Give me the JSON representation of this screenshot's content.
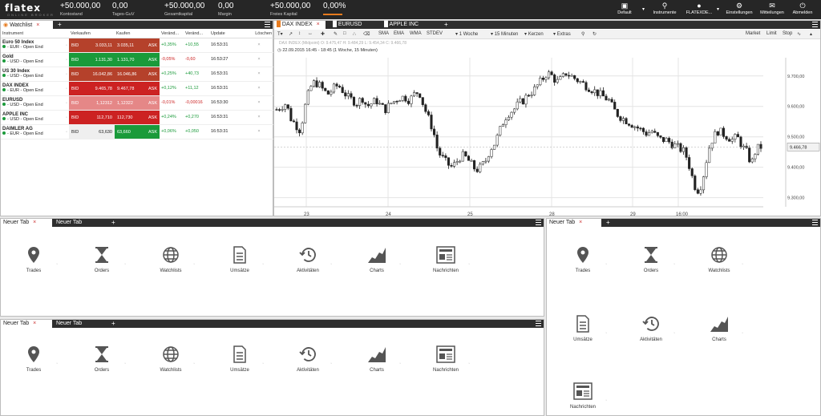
{
  "topbar": {
    "brand": "flatex",
    "brand_sub": "ONLINE BROKER",
    "kpis": [
      {
        "value": "+50.000,00",
        "label": "Kontostand"
      },
      {
        "value": "0,00",
        "label": "Tages-GuV"
      },
      {
        "value": "+50.000,00",
        "label": "Gesamtkapital"
      },
      {
        "value": "0,00",
        "label": "Margin"
      },
      {
        "value": "+50.000,00",
        "label": "Freies Kapital"
      },
      {
        "value": "0,00%",
        "label": ""
      }
    ],
    "buttons": [
      {
        "label": "Default",
        "icon": "monitor-icon"
      },
      {
        "label": "Instrumente",
        "icon": "search-icon"
      },
      {
        "label": "FLATEXDE...",
        "icon": "user-icon"
      },
      {
        "label": "Einstellungen",
        "icon": "gear-icon"
      },
      {
        "label": "Mitteilungen",
        "icon": "envelope-icon"
      },
      {
        "label": "Abmelden",
        "icon": "power-icon"
      }
    ]
  },
  "watchlist": {
    "tab": "Watchlist",
    "columns": [
      "Instrument",
      "Verkaufen",
      "Kaufen",
      "Veränd...",
      "Veränd...",
      "Update",
      "Löschen"
    ],
    "bid_label": "BID",
    "ask_label": "ASK",
    "rows": [
      {
        "name": "Euro 50 Index",
        "sub": "- EUR - Open End",
        "bid": "3.033,11",
        "ask": "3.035,11",
        "chg_pct": "+0,35%",
        "chg": "+10,55",
        "time": "16:53:31",
        "bid_color": "#b5412b",
        "ask_color": "#b5412b",
        "pct_sign": "pos",
        "chg_sign": "pos"
      },
      {
        "name": "Gold",
        "sub": "- USD - Open End",
        "bid": "1.131,30",
        "ask": "1.131,70",
        "chg_pct": "-0,05%",
        "chg": "-0,60",
        "time": "16:53:27",
        "bid_color": "#1a9a3a",
        "ask_color": "#1a9a3a",
        "pct_sign": "neg",
        "chg_sign": "neg"
      },
      {
        "name": "US 30 Index",
        "sub": "- USD - Open End",
        "bid": "16.042,86",
        "ask": "16.046,86",
        "chg_pct": "+0,25%",
        "chg": "+40,73",
        "time": "16:53:31",
        "bid_color": "#b5412b",
        "ask_color": "#b5412b",
        "pct_sign": "pos",
        "chg_sign": "pos"
      },
      {
        "name": "DAX INDEX",
        "sub": "- EUR - Open End",
        "bid": "9.465,78",
        "ask": "9.467,78",
        "chg_pct": "+0,12%",
        "chg": "+11,12",
        "time": "16:53:31",
        "bid_color": "#cc2222",
        "ask_color": "#cc2222",
        "pct_sign": "pos",
        "chg_sign": "pos"
      },
      {
        "name": "EURUSD",
        "sub": "- USD - Open End",
        "bid": "1,12312",
        "ask": "1,12322",
        "chg_pct": "-0,01%",
        "chg": "-0,00016",
        "time": "16:53:30",
        "bid_color": "#e58787",
        "ask_color": "#e58787",
        "pct_sign": "neg",
        "chg_sign": "neg"
      },
      {
        "name": "APPLE INC",
        "sub": "- USD - Open End",
        "bid": "112,710",
        "ask": "112,730",
        "chg_pct": "+0,24%",
        "chg": "+0,270",
        "time": "16:53:31",
        "bid_color": "#cc2222",
        "ask_color": "#cc2222",
        "pct_sign": "pos",
        "chg_sign": "pos"
      },
      {
        "name": "DAIMLER AG",
        "sub": "- EUR - Open End",
        "bid": "63,630",
        "ask": "63,660",
        "chg_pct": "+0,06%",
        "chg": "+0,050",
        "time": "16:53:31",
        "bid_color": "#efefef",
        "ask_color": "#1a9a3a",
        "pct_sign": "pos",
        "chg_sign": "pos"
      }
    ]
  },
  "chart": {
    "tabs": [
      "DAX INDEX",
      "EURUSD",
      "APPLE INC"
    ],
    "toolbar": [
      "SMA",
      "EMA",
      "WMA",
      "STDEV",
      "1 Woche",
      "15 Minuten",
      "Kerzen",
      "Extras"
    ],
    "order_buttons": [
      "Market",
      "Limit",
      "Stop"
    ],
    "info_line": "DAX INDEX (Midpoint) O: 9.475,47 H: 9.484,29 L: 9.454,34 C: 9.466,78",
    "range_line": "22.09.2015 16:45 - 18:45 (1 Woche, 15 Minuten)",
    "current_price": "9.466,78",
    "y_ticks": [
      "9.700,00",
      "9.600,00",
      "9.500,00",
      "9.400,00",
      "9.300,00"
    ],
    "x_ticks": [
      "23",
      "24",
      "25",
      "28",
      "29",
      "16:00"
    ]
  },
  "chart_data": {
    "type": "candlestick",
    "title": "DAX INDEX",
    "ylim": [
      9270,
      9760
    ],
    "x": [
      "23",
      "24",
      "25",
      "28",
      "29",
      "16:00"
    ],
    "close_path": [
      9590,
      9600,
      9610,
      9560,
      9540,
      9520,
      9600,
      9660,
      9680,
      9670,
      9650,
      9640,
      9660,
      9670,
      9650,
      9630,
      9620,
      9610,
      9630,
      9600,
      9610,
      9620,
      9600,
      9590,
      9610,
      9620,
      9630,
      9630,
      9620,
      9640,
      9650,
      9600,
      9560,
      9520,
      9450,
      9430,
      9410,
      9400,
      9420,
      9440,
      9430,
      9410,
      9390,
      9400,
      9420,
      9460,
      9480,
      9520,
      9560,
      9580,
      9590,
      9610,
      9620,
      9640,
      9650,
      9670,
      9690,
      9710,
      9700,
      9680,
      9690,
      9710,
      9700,
      9690,
      9680,
      9670,
      9660,
      9650,
      9640,
      9630,
      9620,
      9590,
      9570,
      9560,
      9550,
      9540,
      9530,
      9520,
      9510,
      9520,
      9500,
      9490,
      9490,
      9480,
      9470,
      9460,
      9450,
      9400,
      9340,
      9320,
      9380,
      9460,
      9500,
      9520,
      9510,
      9500,
      9490,
      9500,
      9470,
      9450,
      9410,
      9460,
      9467
    ]
  },
  "layout_tabs": {
    "panel_a": [
      "Neuer Tab",
      "Neuer Tab"
    ],
    "panel_b": [
      "Neuer Tab"
    ],
    "panel_c": [
      "Neuer Tab",
      "Neuer Tab"
    ]
  },
  "tiles": [
    {
      "label": "Trades",
      "icon": "location-pin-icon"
    },
    {
      "label": "Orders",
      "icon": "hourglass-icon"
    },
    {
      "label": "Watchlists",
      "icon": "globe-icon"
    },
    {
      "label": "Umsätze",
      "icon": "document-icon"
    },
    {
      "label": "Aktivitäten",
      "icon": "history-clock-icon"
    },
    {
      "label": "Charts",
      "icon": "area-chart-icon"
    },
    {
      "label": "Nachrichten",
      "icon": "newspaper-icon"
    }
  ]
}
